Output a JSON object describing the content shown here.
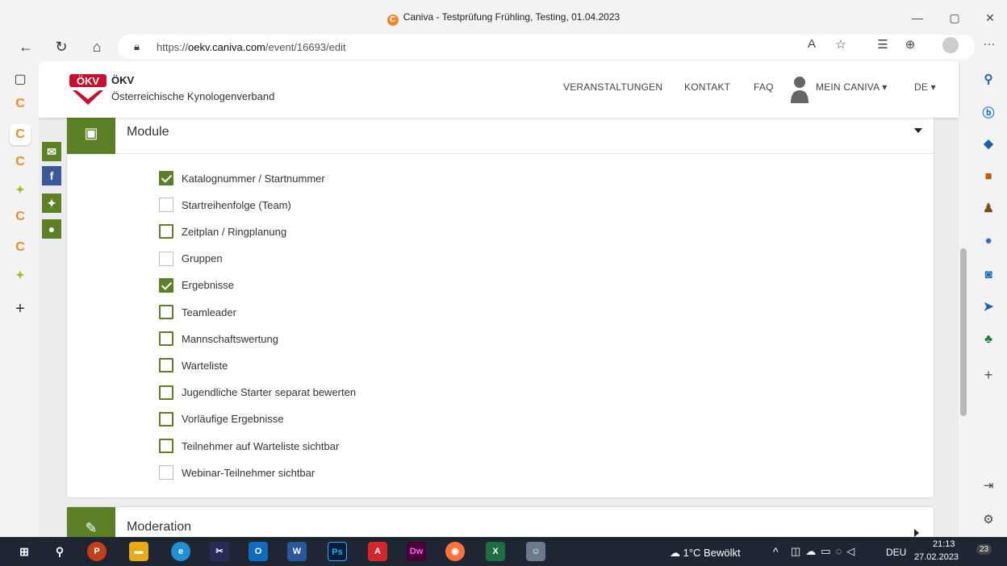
{
  "window": {
    "title": "Caniva - Testprüfung Frühling, Testing, 01.04.2023",
    "minimize": "—",
    "restore": "▢",
    "close": "✕"
  },
  "browser": {
    "url_prefix": "https://",
    "url_domain": "oekv.caniva.com",
    "url_path": "/event/16693/edit",
    "read_aloud_label": "A",
    "more_label": "···"
  },
  "site": {
    "logo_text": "ÖKV",
    "brand_name": "ÖKV",
    "brand_sub": "Österreichische Kynologenverband",
    "nav": {
      "veranstaltungen": "VERANSTALTUNGEN",
      "kontakt": "KONTAKT",
      "faq": "FAQ",
      "mein_caniva": "MEIN CANIVA ▾",
      "lang": "DE ▾"
    },
    "accent_color": "#5b8025"
  },
  "module_section": {
    "title": "Module",
    "options": [
      {
        "label": "Katalognummer / Startnummer",
        "checked": true,
        "enabled": true
      },
      {
        "label": "Startreihenfolge (Team)",
        "checked": false,
        "enabled": false
      },
      {
        "label": "Zeitplan / Ringplanung",
        "checked": false,
        "enabled": true
      },
      {
        "label": "Gruppen",
        "checked": false,
        "enabled": false
      },
      {
        "label": "Ergebnisse",
        "checked": true,
        "enabled": true
      },
      {
        "label": "Teamleader",
        "checked": false,
        "enabled": true
      },
      {
        "label": "Mannschaftswertung",
        "checked": false,
        "enabled": true
      },
      {
        "label": "Warteliste",
        "checked": false,
        "enabled": true
      },
      {
        "label": "Jugendliche Starter separat bewerten",
        "checked": false,
        "enabled": true
      },
      {
        "label": "Vorläufige Ergebnisse",
        "checked": false,
        "enabled": true
      },
      {
        "label": "Teilnehmer auf Warteliste sichtbar",
        "checked": false,
        "enabled": true
      },
      {
        "label": "Webinar-Teilnehmer sichtbar",
        "checked": false,
        "enabled": false
      }
    ]
  },
  "moderation_section": {
    "title": "Moderation"
  },
  "taskbar": {
    "weather": "1°C Bewölkt",
    "language": "DEU",
    "time": "21:13",
    "date": "27.02.2023",
    "notifications": "23"
  }
}
